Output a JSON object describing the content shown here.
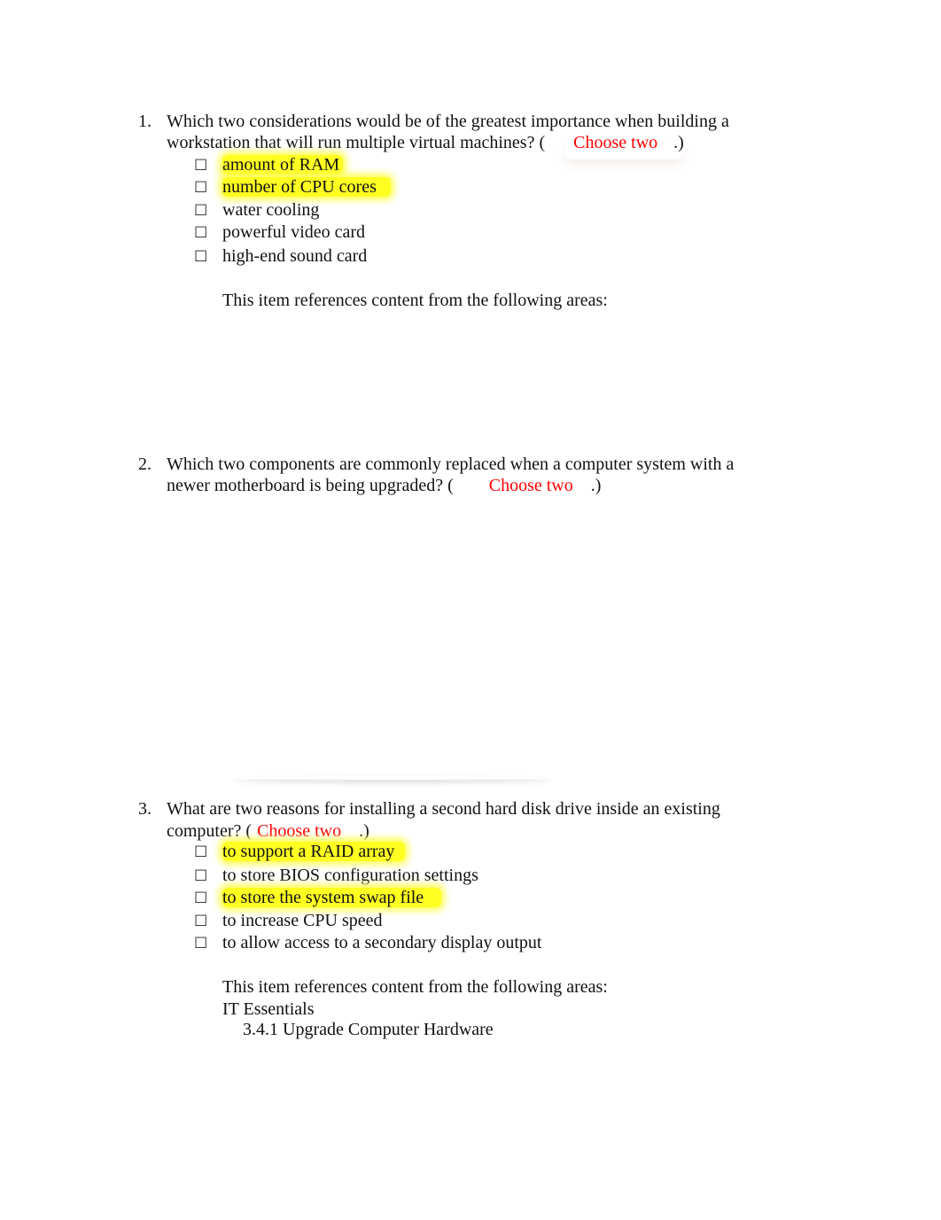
{
  "questions": [
    {
      "number": "1.",
      "line1": "Which two considerations would be of the greatest importance when building a",
      "line2_prefix": "workstation that will run multiple virtual machines? (",
      "choose": "Choose two",
      "line2_suffix": ".)",
      "options": [
        {
          "label": "amount of RAM",
          "highlighted": true
        },
        {
          "label": "number of CPU cores",
          "highlighted": true
        },
        {
          "label": "water cooling",
          "highlighted": false
        },
        {
          "label": "powerful video card",
          "highlighted": false
        },
        {
          "label": "high-end sound card",
          "highlighted": false
        }
      ],
      "reference_intro": "This item references content from the following areas:"
    },
    {
      "number": "2.",
      "line1": "Which two components are commonly replaced when a computer system with a",
      "line2_prefix": "newer motherboard is being upgraded? (",
      "choose": "Choose two",
      "line2_suffix": ".)"
    },
    {
      "number": "3.",
      "line1": "What are two reasons for installing a second hard disk drive inside an existing",
      "line2_prefix": "computer? (",
      "choose": "Choose two",
      "line2_suffix": ".)",
      "options": [
        {
          "label": "to support a RAID array",
          "highlighted": true
        },
        {
          "label": "to store BIOS configuration settings",
          "highlighted": false
        },
        {
          "label": "to store the system swap file",
          "highlighted": true
        },
        {
          "label": "to increase CPU speed",
          "highlighted": false
        },
        {
          "label": "to allow access to a secondary display output",
          "highlighted": false
        }
      ],
      "reference_intro": "This item references content from the following areas:",
      "reference_course": "IT Essentials",
      "reference_section": "3.4.1 Upgrade Computer Hardware"
    }
  ],
  "checkbox_glyph": "☐",
  "colors": {
    "highlight": "#ffff22",
    "choose_text": "#ff0000",
    "body_text": "#111111"
  }
}
